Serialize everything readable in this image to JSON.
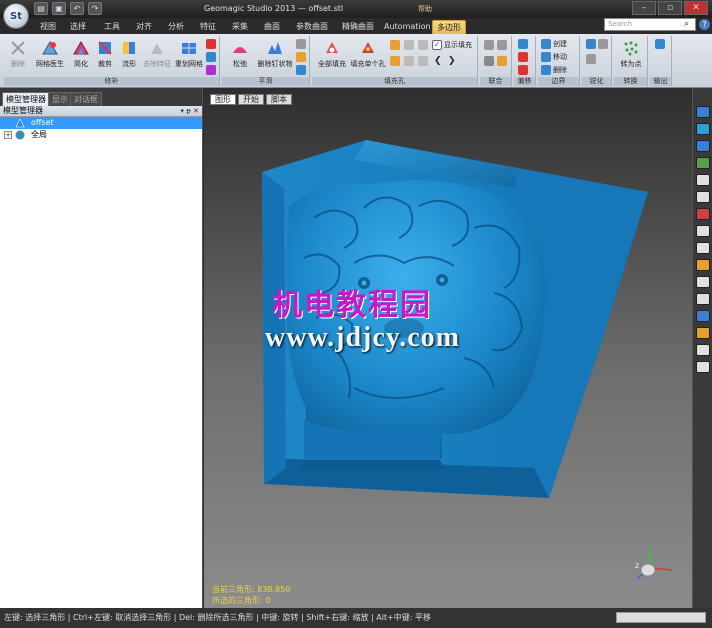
{
  "titlebar": {
    "logo_text": "St",
    "title": "Geomagic Studio 2013 — offset.stl",
    "help_title": "帮助"
  },
  "ribbon_tabs": [
    "视图",
    "选择",
    "工具",
    "对齐",
    "分析",
    "特征",
    "采集",
    "曲面",
    "参数曲面",
    "精确曲面",
    "Automation",
    "多边形"
  ],
  "search": {
    "placeholder": "Search"
  },
  "ribbon": {
    "groups": [
      {
        "label": "修补"
      },
      {
        "label": "平滑"
      },
      {
        "label": "填充孔"
      },
      {
        "label": "联合"
      },
      {
        "label": "偏移"
      },
      {
        "label": "边界"
      },
      {
        "label": "锐化"
      },
      {
        "label": "转换"
      },
      {
        "label": "输出"
      }
    ],
    "buttons": {
      "delete": "删除",
      "mesh_doctor": "网格医生",
      "simplify": "简化",
      "trim": "裁剪",
      "shape": "流形",
      "remove_feature": "去除特征",
      "remesh": "重划网格",
      "relax": "松弛",
      "remove_spikes": "删除钉状物",
      "fill_all": "全部填充",
      "fill_single": "填充单个孔",
      "show_fill": "显示填充",
      "create": "创建",
      "move": "移动",
      "delete_b": "删除",
      "to_points": "转为点"
    }
  },
  "left_panel": {
    "tabs": [
      "模型管理器",
      "显示",
      "对话框"
    ],
    "header": "模型管理器",
    "controls": "▾ ᵽ ✕",
    "tree": [
      {
        "label": "offset",
        "selected": true
      },
      {
        "label": "全局",
        "selected": false
      }
    ]
  },
  "viewport": {
    "tabs": [
      "图形",
      "开始",
      "脚本"
    ],
    "stat_current": "当前三角形: 838,850",
    "stat_selected": "所选的三角形: 0"
  },
  "watermark": {
    "line1": "机电教程园",
    "line2": "www.jdjcy.com"
  },
  "statusbar": {
    "text": "左键: 选择三角形 | Ctrl+左键: 取消选择三角形 | Del: 删除所选三角形 | 中键: 旋转 | Shift+右键: 缩放 | Alt+中键: 平移"
  },
  "colors": {
    "model": "#1a86c8",
    "accent_tab": "#e8b850",
    "watermark_magenta": "#c818c8",
    "stat_yellow": "#e9d24b"
  }
}
